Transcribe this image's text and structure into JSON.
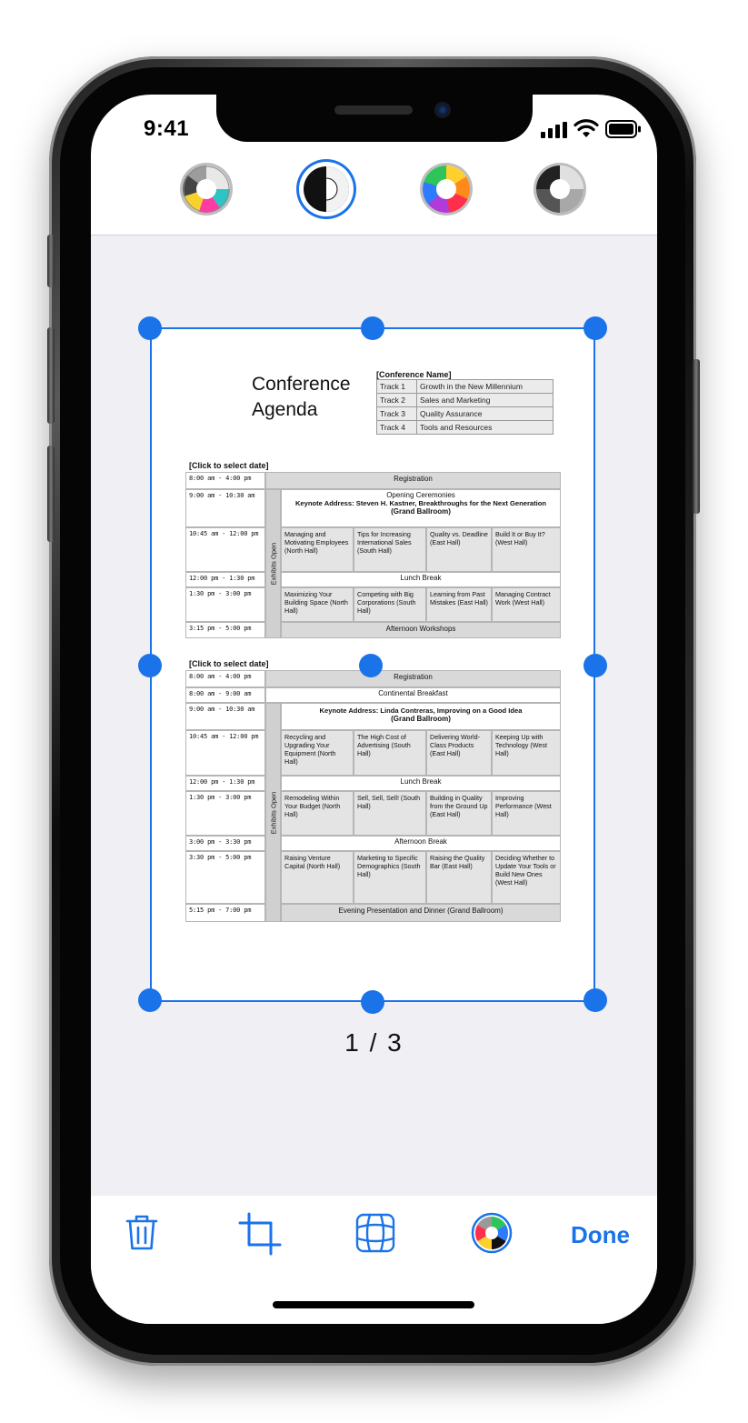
{
  "status_bar": {
    "time": "9:41"
  },
  "filters": [
    {
      "name": "color-filter"
    },
    {
      "name": "grayscale-filter",
      "selected": true
    },
    {
      "name": "photo-filter"
    },
    {
      "name": "bw-filter"
    }
  ],
  "document": {
    "title_line1": "Conference",
    "title_line2": "Agenda",
    "conference_name": "[Conference Name]",
    "tracks": [
      {
        "track": "Track 1",
        "name": "Growth in the New Millennium"
      },
      {
        "track": "Track 2",
        "name": "Sales and Marketing"
      },
      {
        "track": "Track 3",
        "name": "Quality Assurance"
      },
      {
        "track": "Track 4",
        "name": "Tools and Resources"
      }
    ],
    "day1": {
      "date": "[Click to select date]",
      "exhibits": "Exhibits Open",
      "t1": "8:00 am - 4:00 pm",
      "registration": "Registration",
      "t2": "9:00 am - 10:30 am",
      "opening": "Opening Ceremonies",
      "keynote": "Keynote Address: Steven H. Kastner, Breakthroughs for the Next Generation",
      "keynote_room": "(Grand Ballroom)",
      "t3": "10:45 am - 12:00 pm",
      "s1": "Managing and Motivating Employees (North Hall)",
      "s2": "Tips for Increasing International Sales (South Hall)",
      "s3": "Quality vs. Deadline (East Hall)",
      "s4": "Build It or Buy It? (West Hall)",
      "t4": "12:00 pm - 1:30 pm",
      "lunch": "Lunch Break",
      "t5": "1:30 pm - 3:00 pm",
      "s5": "Maximizing Your Building Space (North Hall)",
      "s6": "Competing with Big Corporations (South Hall)",
      "s7": "Learning from Past Mistakes (East Hall)",
      "s8": "Managing Contract Work (West Hall)",
      "t6": "3:15 pm - 5:00 pm",
      "afternoon": "Afternoon Workshops"
    },
    "day2": {
      "date": "[Click to select date]",
      "exhibits": "Exhibits Open",
      "t1": "8:00 am - 4:00 pm",
      "registration": "Registration",
      "t2": "8:00 am - 9:00 am",
      "breakfast": "Continental Breakfast",
      "t3": "9:00 am - 10:30 am",
      "keynote": "Keynote Address: Linda Contreras, Improving on a Good Idea",
      "keynote_room": "(Grand Ballroom)",
      "t4": "10:45 am - 12:00 pm",
      "s1": "Recycling and Upgrading Your Equipment (North Hall)",
      "s2": "The High Cost of Advertising (South Hall)",
      "s3": "Delivering World-Class Products (East Hall)",
      "s4": "Keeping Up with Technology (West Hall)",
      "t5": "12:00 pm - 1:30 pm",
      "lunch": "Lunch Break",
      "t6": "1:30 pm - 3:00 pm",
      "s5": "Remodeling Within Your Budget (North Hall)",
      "s6": "Sell, Sell, Sell! (South Hall)",
      "s7": "Building in Quality from the Ground Up (East Hall)",
      "s8": "Improving Performance (West Hall)",
      "t7": "3:00 pm - 3:30 pm",
      "break": "Afternoon Break",
      "t8": "3:30 pm - 5:00 pm",
      "s9": "Raising Venture Capital (North Hall)",
      "s10": "Marketing to Specific Demographics (South Hall)",
      "s11": "Raising the Quality Bar (East Hall)",
      "s12": "Deciding Whether to Update Your Tools or Build New Ones (West Hall)",
      "t9": "5:15 pm - 7:00 pm",
      "evening": "Evening Presentation and Dinner (Grand Ballroom)"
    }
  },
  "page_indicator": "1 / 3",
  "toolbar": {
    "delete_icon": "trash-icon",
    "crop_icon": "crop-icon",
    "warp_icon": "perspective-grid-icon",
    "filter_icon": "color-wheel-icon",
    "done_label": "Done"
  },
  "colors": {
    "accent": "#1a73e8",
    "workspace": "#efeff4"
  }
}
